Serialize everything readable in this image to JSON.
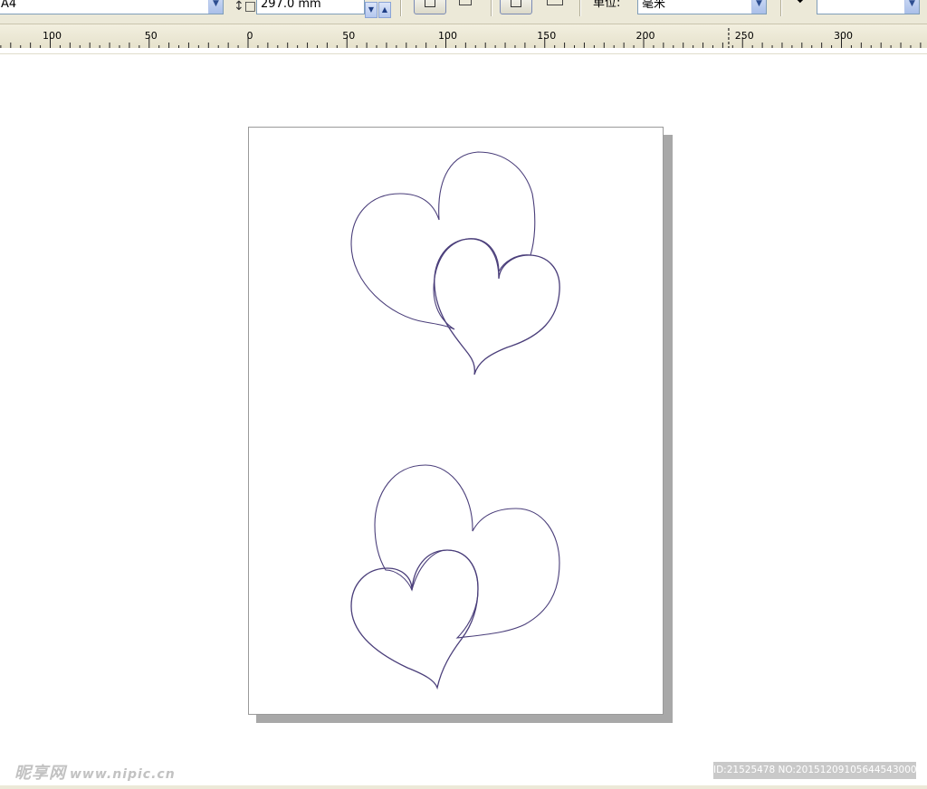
{
  "property_bar": {
    "page_size_value": "A4",
    "page_height_value": "297.0 mm",
    "units_label": "单位:",
    "units_value": "毫米",
    "nudge_value": ""
  },
  "ruler": {
    "unit": "mm",
    "tick_labels": [
      "100",
      "50",
      "0",
      "50",
      "100",
      "150",
      "200",
      "250",
      "300"
    ]
  },
  "document": {
    "shapes": [
      {
        "name": "heart-outline-top-large",
        "color": "#4a3e7a"
      },
      {
        "name": "heart-outline-top-small",
        "color": "#4a3e7a"
      },
      {
        "name": "heart-outline-bottom-large",
        "color": "#4a3e7a"
      },
      {
        "name": "heart-outline-bottom-small",
        "color": "#4a3e7a"
      }
    ]
  },
  "watermark": {
    "brand": "昵享网",
    "site": "www.nipic.cn",
    "id_text": "ID:21525478 NO:20151209105644543000"
  },
  "colors": {
    "toolbar_bg": "#ece9d8",
    "ruler_bg": "#ece9d8",
    "page_shadow": "#a8a8a8",
    "heart_stroke": "#4a3e7a"
  }
}
